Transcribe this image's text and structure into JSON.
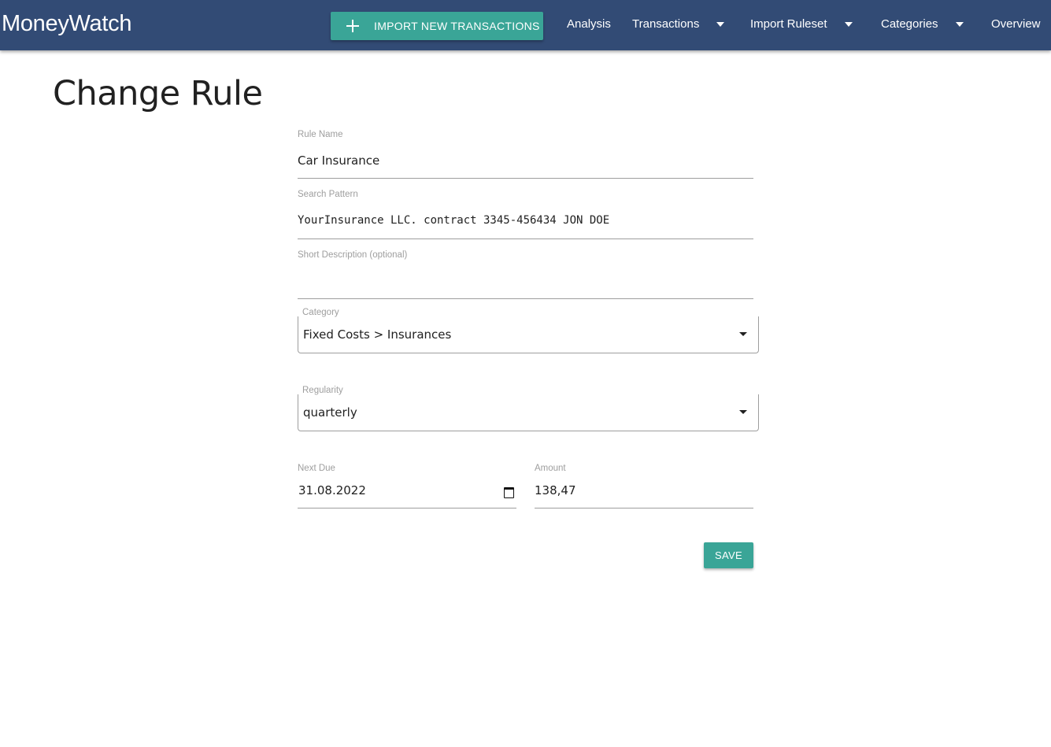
{
  "navbar": {
    "brand": "MoneyWatch",
    "import_button_label": "IMPORT NEW TRANSACTIONS",
    "import_button_icon": "plus-icon",
    "items": [
      {
        "label": "Analysis",
        "has_dropdown": false
      },
      {
        "label": "Transactions",
        "has_dropdown": true
      },
      {
        "label": "Import Ruleset",
        "has_dropdown": true
      },
      {
        "label": "Categories",
        "has_dropdown": true
      },
      {
        "label": "Overview",
        "has_dropdown": false
      }
    ]
  },
  "page": {
    "title": "Change Rule"
  },
  "form": {
    "rule_name": {
      "label": "Rule Name",
      "value": "Car Insurance"
    },
    "search_pattern": {
      "label": "Search Pattern",
      "value": "YourInsurance LLC. contract 3345-456434 JON DOE"
    },
    "short_description": {
      "label": "Short Description (optional)",
      "value": ""
    },
    "category": {
      "label": "Category",
      "value": "Fixed Costs > Insurances"
    },
    "regularity": {
      "label": "Regularity",
      "value": "quarterly"
    },
    "next_due": {
      "label": "Next Due",
      "value": "31.08.2022"
    },
    "amount": {
      "label": "Amount",
      "value": "138,47"
    },
    "save_label": "SAVE"
  },
  "colors": {
    "navbar_bg": "#324b75",
    "accent": "#3aa597"
  }
}
